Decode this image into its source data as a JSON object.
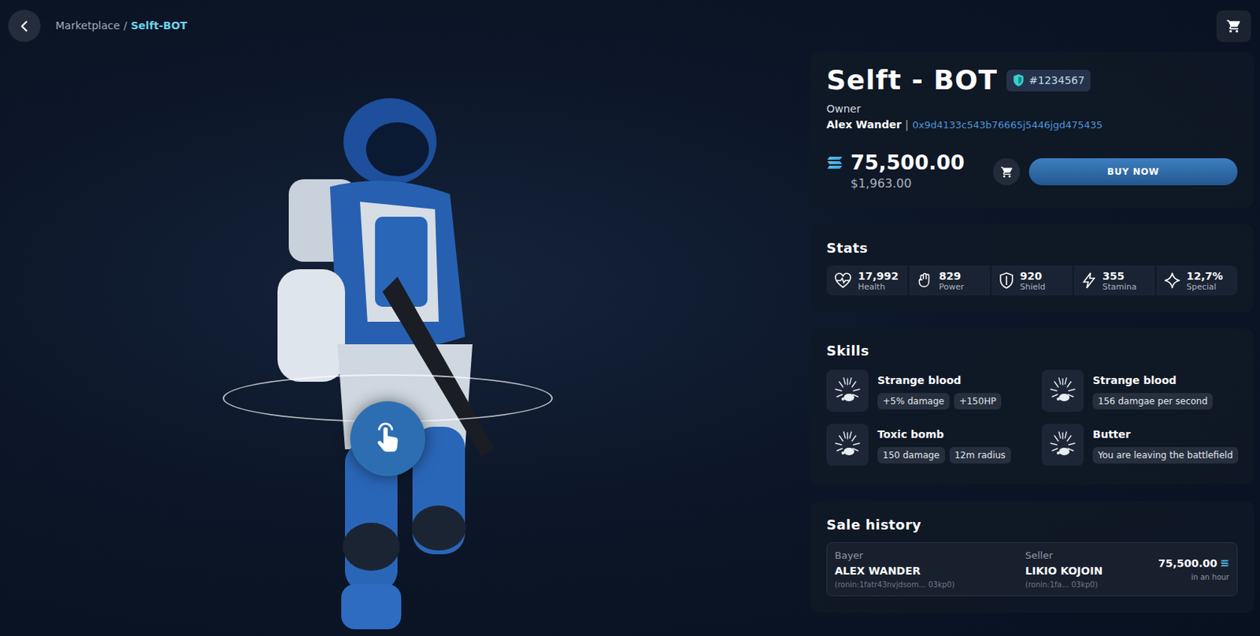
{
  "breadcrumb": {
    "parent": "Marketplace",
    "separator": "/",
    "current": "Selft-BOT"
  },
  "item": {
    "title": "Selft - BOT",
    "id": "#1234567",
    "owner_label": "Owner",
    "owner_name": "Alex Wander",
    "owner_separator": "|",
    "owner_address": "0x9d4133c543b76665j5446jgd475435",
    "price": "75,500.00",
    "price_usd": "$1,963.00",
    "buy_button": "BUY NOW"
  },
  "stats": {
    "title": "Stats",
    "items": [
      {
        "value": "17,992",
        "label": "Health"
      },
      {
        "value": "829",
        "label": "Power"
      },
      {
        "value": "920",
        "label": "Shield"
      },
      {
        "value": "355",
        "label": "Stamina"
      },
      {
        "value": "12,7%",
        "label": "Special"
      }
    ]
  },
  "skills": {
    "title": "Skills",
    "items": [
      {
        "name": "Strange blood",
        "tags": [
          "+5% damage",
          "+150HP"
        ]
      },
      {
        "name": "Strange blood",
        "tags": [
          "156 damgae per second"
        ]
      },
      {
        "name": "Toxic bomb",
        "tags": [
          "150 damage",
          "12m radius"
        ]
      },
      {
        "name": "Butter",
        "tags": [
          "You are leaving the battlefield"
        ]
      }
    ]
  },
  "sale_history": {
    "title": "Sale history",
    "buyer_label": "Bayer",
    "seller_label": "Seller",
    "rows": [
      {
        "buyer": "ALEX WANDER",
        "buyer_address": "(ronin:1fatr43nvjdsom... 03kp0)",
        "seller": "LIKIO KOJOIN",
        "seller_address": "(ronin:1fa... 03kp0)",
        "price": "75,500.00",
        "time": "in an hour"
      }
    ]
  }
}
